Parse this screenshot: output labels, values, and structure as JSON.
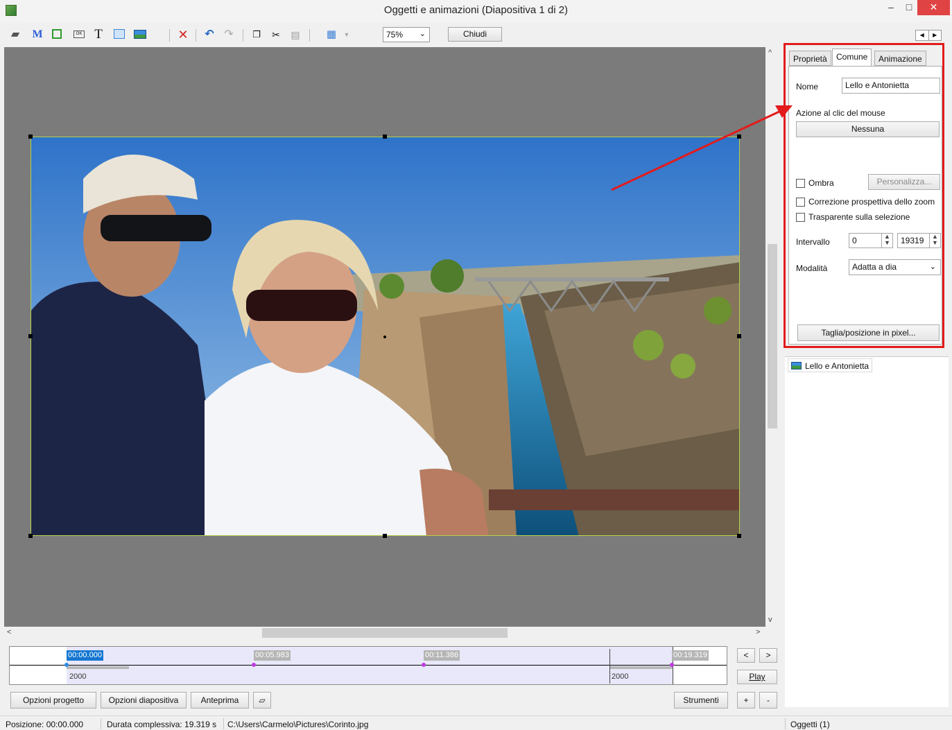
{
  "window": {
    "title": "Oggetti e animazioni  (Diapositiva 1 di 2)",
    "min_label": "–",
    "max_label": "□",
    "close_label": "✕"
  },
  "toolbar": {
    "zoom_value": "75%",
    "close_label": "Chiudi",
    "icons": [
      "camera-icon",
      "mask-icon",
      "frame-icon",
      "button-icon",
      "text-icon",
      "rectangle-icon",
      "image-icon",
      "delete-icon",
      "undo-icon",
      "redo-icon",
      "copy-icon",
      "cut-icon",
      "paste-icon",
      "grid-icon"
    ]
  },
  "panel": {
    "tabs": [
      "Proprietà",
      "Comune",
      "Animazione"
    ],
    "active_tab": "Comune",
    "name_label": "Nome",
    "name_value": "Lello e Antonietta",
    "mouse_action_label": "Azione al clic del mouse",
    "mouse_action_button": "Nessuna",
    "shadow_label": "Ombra",
    "customize_label": "Personalizza...",
    "zoom_perspective_label": "Correzione prospettiva dello zoom",
    "transparent_label": "Trasparente sulla selezione",
    "interval_label": "Intervallo",
    "interval_start": "0",
    "interval_end": "19319",
    "mode_label": "Modalità",
    "mode_value": "Adatta a dia",
    "crop_button": "Taglia/posizione in pixel..."
  },
  "objects": {
    "items": [
      "Lello e Antonietta"
    ]
  },
  "timeline": {
    "times": [
      "00:00.000",
      "00:05.983",
      "00:11.386",
      "00:19.319"
    ],
    "transition_start": "2000",
    "transition_end": "2000",
    "prev_label": "<",
    "next_label": ">",
    "play_label": "Play",
    "plus_label": "+",
    "minus_label": "-"
  },
  "bottom": {
    "project_options": "Opzioni progetto",
    "slide_options": "Opzioni diapositiva",
    "preview": "Anteprima",
    "tools": "Strumenti"
  },
  "status": {
    "position": "Posizione:  00:00.000",
    "total_duration": "Durata complessiva:  19.319 s",
    "file_path": "C:\\Users\\Carmelo\\Pictures\\Corinto.jpg",
    "objects_count": "Oggetti (1)"
  },
  "colors": {
    "annotation_red": "#e31b1b",
    "canvas_grey": "#7b7b7b",
    "selection_green": "#b7d14b",
    "current_time_blue": "#1577d1",
    "keyframe_purple": "#c03be0"
  }
}
